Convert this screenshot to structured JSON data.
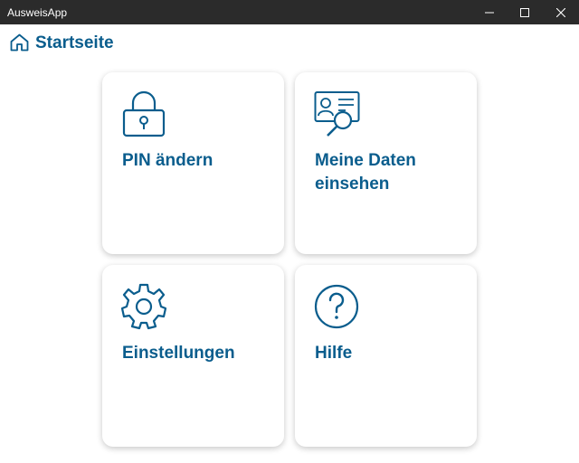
{
  "window": {
    "title": "AusweisApp"
  },
  "header": {
    "title": "Startseite",
    "icon": "home-icon"
  },
  "tiles": [
    {
      "label": "PIN ändern",
      "icon": "lock-icon"
    },
    {
      "label": "Meine Daten einsehen",
      "icon": "id-card-search-icon"
    },
    {
      "label": "Einstellungen",
      "icon": "gear-icon"
    },
    {
      "label": "Hilfe",
      "icon": "help-icon"
    }
  ],
  "colors": {
    "accent": "#0a5d8d",
    "titlebar": "#2b2b2b",
    "background": "#ffffff"
  }
}
